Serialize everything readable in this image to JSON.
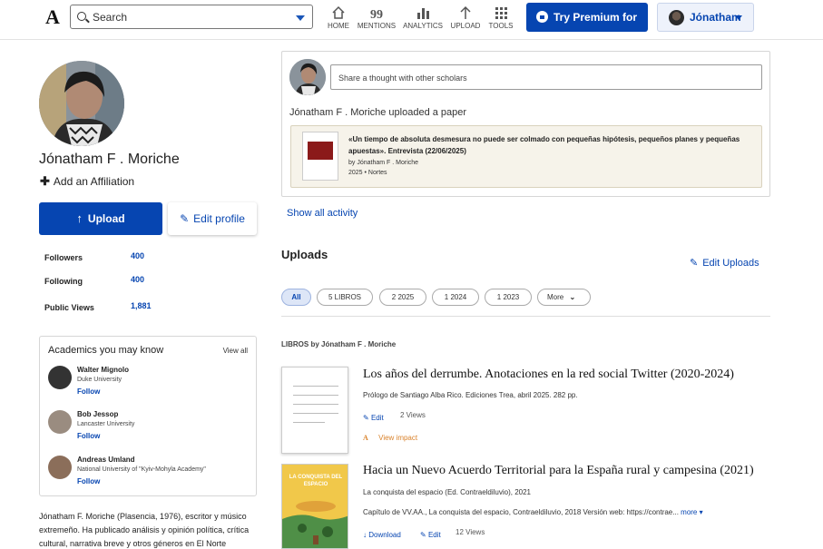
{
  "header": {
    "logo": "A",
    "search_placeholder": "Search",
    "nav": [
      {
        "label": "HOME",
        "icon": "home-icon"
      },
      {
        "label": "MENTIONS",
        "icon": "quote-icon"
      },
      {
        "label": "ANALYTICS",
        "icon": "bar-chart-icon"
      },
      {
        "label": "UPLOAD",
        "icon": "upload-arrow-icon"
      },
      {
        "label": "TOOLS",
        "icon": "grid-icon"
      }
    ],
    "premium_label": "Try Premium for €1",
    "user_label": "Jónatham"
  },
  "profile": {
    "name": "Jónatham F . Moriche",
    "add_affiliation": "Add an Affiliation",
    "upload_label": "Upload",
    "edit_profile_label": "Edit profile",
    "stats": [
      {
        "label": "Followers",
        "value": "400"
      },
      {
        "label": "Following",
        "value": "400"
      },
      {
        "label": "Public Views",
        "value": "1,881"
      }
    ],
    "bio": "Jónatham F. Moriche (Plasencia, 1976), escritor y músico extremeño. Ha publicado análisis y opinión política, crítica cultural, narrativa breve y otros géneros en El Norte"
  },
  "academics": {
    "title": "Academics you may know",
    "view_all": "View all",
    "people": [
      {
        "name": "Walter Mignolo",
        "university": "Duke University",
        "follow": "Follow"
      },
      {
        "name": "Bob Jessop",
        "university": "Lancaster University",
        "follow": "Follow"
      },
      {
        "name": "Andreas Umland",
        "university": "National University of \"Kyiv-Mohyla Academy\"",
        "follow": "Follow"
      }
    ]
  },
  "feed": {
    "share_placeholder": "Share a thought with other scholars",
    "activity_text": "Jónatham F . Moriche uploaded a paper",
    "paper_title": "«Un tiempo de absoluta desmesura no puede ser colmado con pequeñas hipótesis, pequeños planes y pequeñas apuestas». Entrevista (22/06/2025)",
    "paper_by": "by Jónatham F . Moriche",
    "paper_meta": "2025 • Nortes",
    "show_all": "Show all activity"
  },
  "uploads": {
    "title": "Uploads",
    "edit_label": "Edit Uploads",
    "filters": [
      "All",
      "5 LIBROS",
      "2 2025",
      "1 2024",
      "1 2023",
      "More"
    ],
    "section_label": "LIBROS by Jónatham F . Moriche",
    "items": [
      {
        "title": "Los años del derrumbe. Anotaciones en la red social Twitter (2020-2024)",
        "subtitle": "Prólogo de Santiago Alba Rico. Ediciones Trea, abril 2025. 282 pp.",
        "edit": "Edit",
        "views": "2 Views",
        "impact": "View impact"
      },
      {
        "title": "Hacia un Nuevo Acuerdo Territorial para la España rural y campesina (2021)",
        "subtitle": "La conquista del espacio (Ed. Contraeldiluvio), 2021",
        "description": "Capítulo de VV.AA., La conquista del espacio, Contraeldiluvio, 2018 Versión web: https://contrae...",
        "more": "more",
        "download": "Download",
        "edit": "Edit",
        "views": "12 Views",
        "cover_text": "LA CONQUISTA DEL ESPACIO"
      }
    ]
  }
}
